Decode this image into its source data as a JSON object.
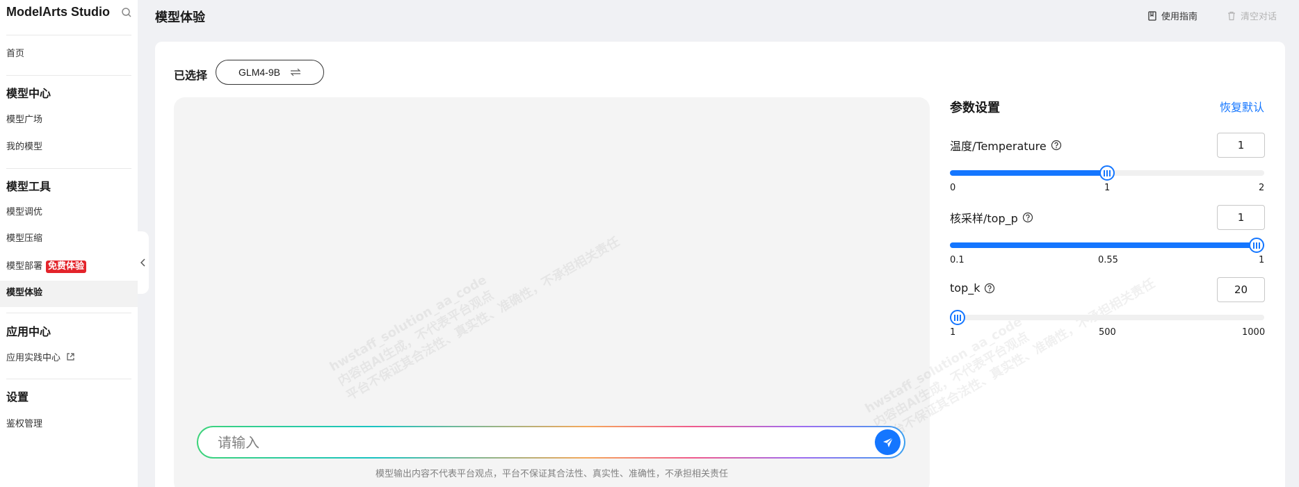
{
  "sidebar": {
    "brand": "ModelArts Studio",
    "home": "首页",
    "group_model_center": "模型中心",
    "model_square": "模型广场",
    "my_models": "我的模型",
    "group_model_tools": "模型工具",
    "model_tuning": "模型调优",
    "model_compress": "模型压缩",
    "model_deploy": "模型部署",
    "free_badge": "免费体验",
    "model_experience": "模型体验",
    "group_app_center": "应用中心",
    "app_practice": "应用实践中心",
    "group_settings": "设置",
    "auth_management": "鉴权管理"
  },
  "header": {
    "title": "模型体验",
    "guide": "使用指南",
    "clear": "清空对话"
  },
  "main": {
    "selected_label": "已选择",
    "model_name": "GLM4-9B",
    "input_placeholder": "请输入",
    "disclaimer": "模型输出内容不代表平台观点，平台不保证其合法性、真实性、准确性，不承担相关责任",
    "watermark": {
      "line1": "hwstaff_solution_aa_code",
      "line2": "内容由AI生成，不代表平台观点",
      "line3": "平台不保证其合法性、真实性、准确性，不承担相关责任"
    }
  },
  "params": {
    "title": "参数设置",
    "restore": "恢复默认",
    "temperature": {
      "label": "温度/Temperature",
      "value": "1",
      "min": 0,
      "max": 2,
      "current": 1,
      "ticks": [
        "0",
        "1",
        "2"
      ]
    },
    "top_p": {
      "label": "核采样/top_p",
      "value": "1",
      "min": 0.1,
      "max": 1,
      "current": 1,
      "ticks": [
        "0.1",
        "0.55",
        "1"
      ]
    },
    "top_k": {
      "label": "top_k",
      "value": "20",
      "min": 1,
      "max": 1000,
      "current": 20,
      "ticks": [
        "1",
        "500",
        "1000"
      ]
    }
  },
  "colors": {
    "accent": "#1476ff",
    "badge": "#e3242b"
  }
}
